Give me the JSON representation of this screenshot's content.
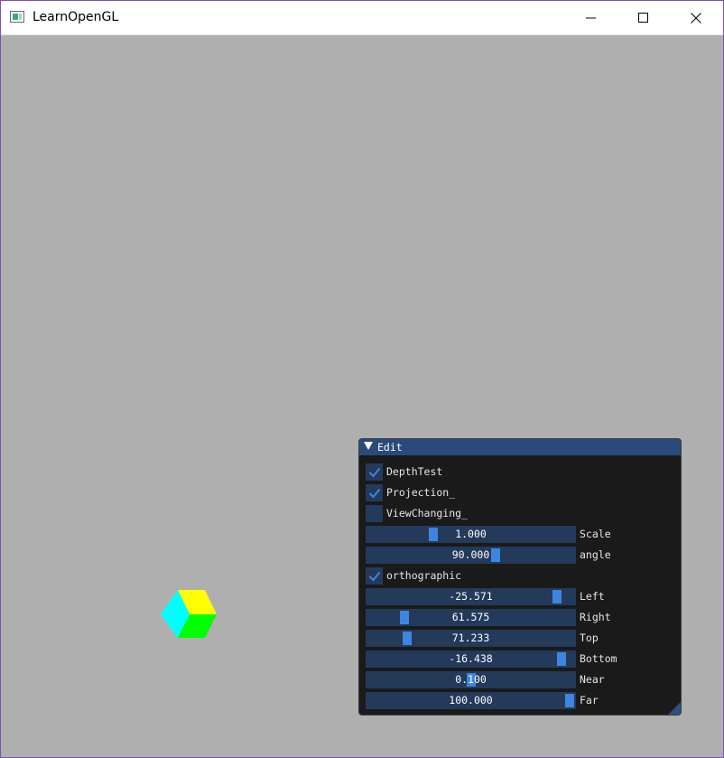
{
  "window": {
    "title": "LearnOpenGL",
    "controls": {
      "minimize_icon": "minimize-icon",
      "maximize_icon": "maximize-icon",
      "close_icon": "close-icon"
    },
    "background_color": "#afafaf"
  },
  "scene": {
    "cube_face_colors": [
      "#ffff00",
      "#00ffff",
      "#00ff00"
    ]
  },
  "panel": {
    "title": "Edit",
    "header_color": "#294a7a",
    "accent_color": "#3d85e0",
    "checkboxes": {
      "depth_test": {
        "label": "DepthTest",
        "checked": true
      },
      "projection": {
        "label": "Projection_",
        "checked": true
      },
      "view_changing": {
        "label": "ViewChanging_",
        "checked": false
      },
      "orthographic": {
        "label": "orthographic",
        "checked": true
      }
    },
    "sliders": {
      "scale": {
        "label": "Scale",
        "value": "1.000"
      },
      "angle": {
        "label": "angle",
        "value": "90.000"
      },
      "left": {
        "label": "Left",
        "value": "-25.571"
      },
      "right": {
        "label": "Right",
        "value": "61.575"
      },
      "top": {
        "label": "Top",
        "value": "71.233"
      },
      "bottom": {
        "label": "Bottom",
        "value": "-16.438"
      },
      "near": {
        "label": "Near",
        "value": "0.100"
      },
      "far": {
        "label": "Far",
        "value": "100.000"
      }
    }
  }
}
